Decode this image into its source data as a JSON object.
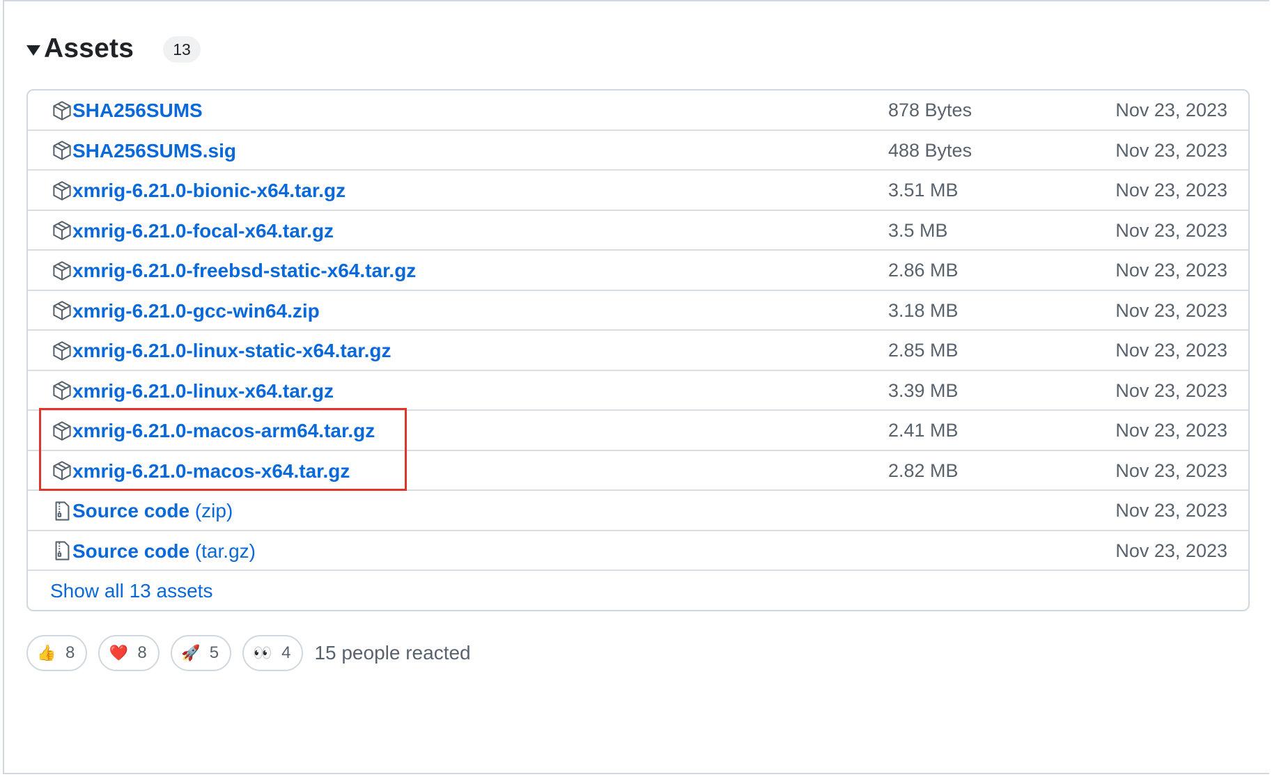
{
  "assets": {
    "title": "Assets",
    "count": "13",
    "rows": [
      {
        "name": "SHA256SUMS",
        "suffix": "",
        "size": "878 Bytes",
        "date": "Nov 23, 2023",
        "icon": "package-icon"
      },
      {
        "name": "SHA256SUMS.sig",
        "suffix": "",
        "size": "488 Bytes",
        "date": "Nov 23, 2023",
        "icon": "package-icon"
      },
      {
        "name": "xmrig-6.21.0-bionic-x64.tar.gz",
        "suffix": "",
        "size": "3.51 MB",
        "date": "Nov 23, 2023",
        "icon": "package-icon"
      },
      {
        "name": "xmrig-6.21.0-focal-x64.tar.gz",
        "suffix": "",
        "size": "3.5 MB",
        "date": "Nov 23, 2023",
        "icon": "package-icon"
      },
      {
        "name": "xmrig-6.21.0-freebsd-static-x64.tar.gz",
        "suffix": "",
        "size": "2.86 MB",
        "date": "Nov 23, 2023",
        "icon": "package-icon"
      },
      {
        "name": "xmrig-6.21.0-gcc-win64.zip",
        "suffix": "",
        "size": "3.18 MB",
        "date": "Nov 23, 2023",
        "icon": "package-icon"
      },
      {
        "name": "xmrig-6.21.0-linux-static-x64.tar.gz",
        "suffix": "",
        "size": "2.85 MB",
        "date": "Nov 23, 2023",
        "icon": "package-icon"
      },
      {
        "name": "xmrig-6.21.0-linux-x64.tar.gz",
        "suffix": "",
        "size": "3.39 MB",
        "date": "Nov 23, 2023",
        "icon": "package-icon"
      },
      {
        "name": "xmrig-6.21.0-macos-arm64.tar.gz",
        "suffix": "",
        "size": "2.41 MB",
        "date": "Nov 23, 2023",
        "icon": "package-icon"
      },
      {
        "name": "xmrig-6.21.0-macos-x64.tar.gz",
        "suffix": "",
        "size": "2.82 MB",
        "date": "Nov 23, 2023",
        "icon": "package-icon"
      },
      {
        "name": "Source code",
        "suffix": " (zip)",
        "size": "",
        "date": "Nov 23, 2023",
        "icon": "file-zip-icon"
      },
      {
        "name": "Source code",
        "suffix": " (tar.gz)",
        "size": "",
        "date": "Nov 23, 2023",
        "icon": "file-zip-icon"
      }
    ],
    "show_all": "Show all 13 assets"
  },
  "reactions": {
    "items": [
      {
        "emoji": "👍",
        "icon": "thumbs-up-icon",
        "count": "8"
      },
      {
        "emoji": "❤️",
        "icon": "heart-icon",
        "count": "8"
      },
      {
        "emoji": "🚀",
        "icon": "rocket-icon",
        "count": "5"
      },
      {
        "emoji": "👀",
        "icon": "eyes-icon",
        "count": "4"
      }
    ],
    "summary": "15 people reacted"
  },
  "colors": {
    "link": "#0969da",
    "muted": "#59636e",
    "border": "#d0d7de",
    "highlight": "#e0332a"
  }
}
